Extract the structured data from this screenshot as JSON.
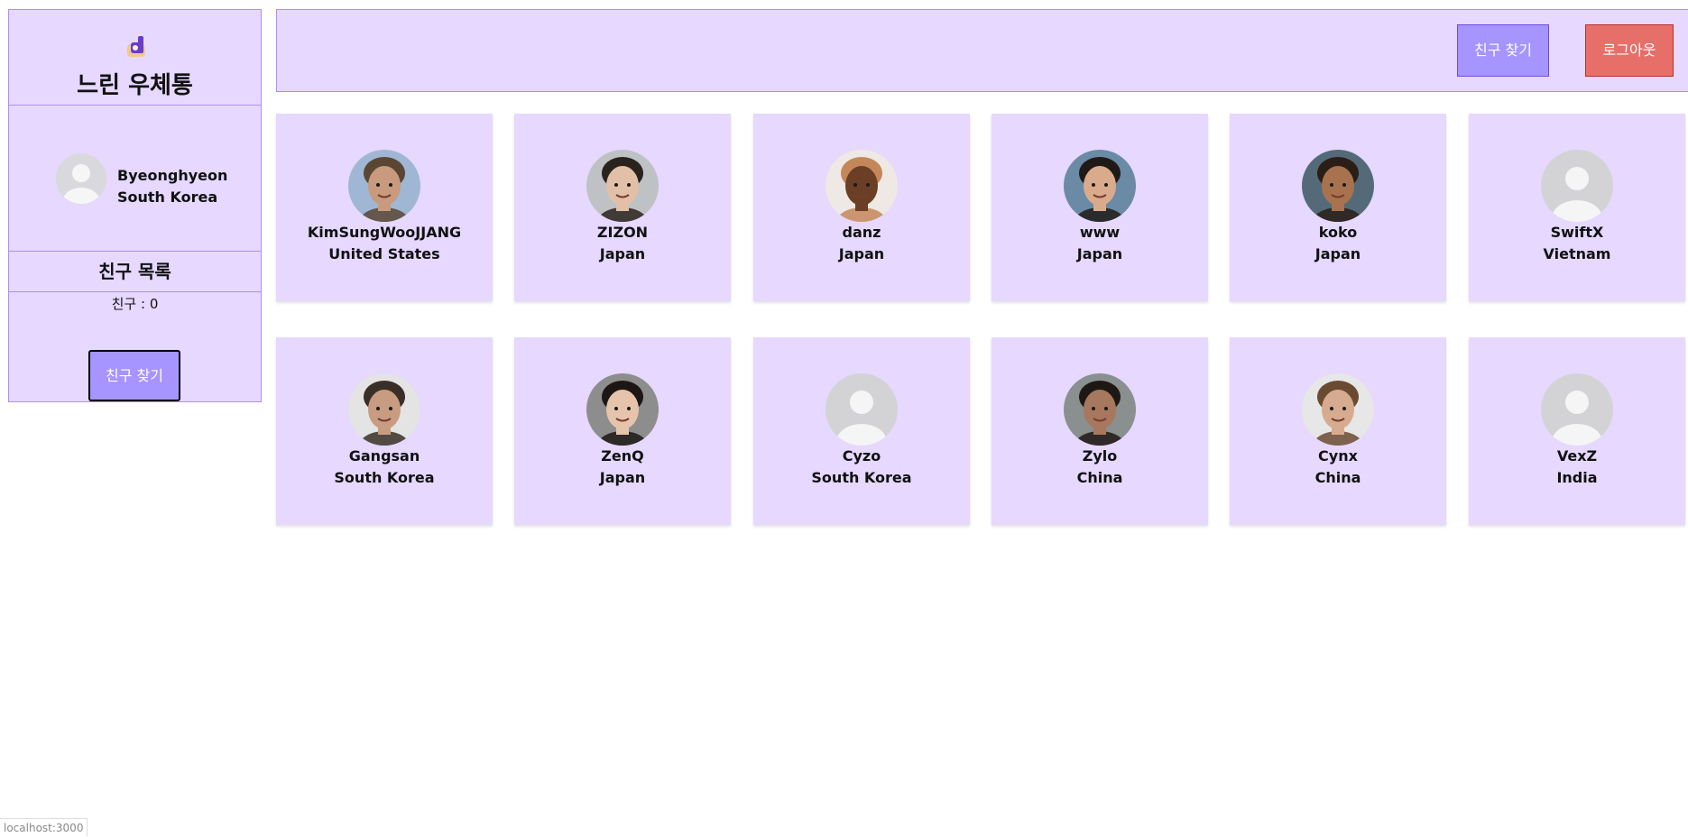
{
  "sidebar": {
    "title": "느린 우체통",
    "profile": {
      "name": "Byeonghyeon",
      "country": "South Korea"
    },
    "friends_header": "친구 목록",
    "friend_count": "친구 : 0",
    "find_button": "친구 찾기"
  },
  "header": {
    "find_button": "친구 찾기",
    "logout_button": "로그아웃"
  },
  "users": [
    {
      "name": "KimSungWooJJANG",
      "country": "United States",
      "avatar": "photo-man-glasses",
      "skin": "#c89a7e",
      "hair": "#5b4634",
      "bg": "#9fb7d4"
    },
    {
      "name": "ZIZON",
      "country": "Japan",
      "avatar": "photo-woman-glasses",
      "skin": "#e2c0a8",
      "hair": "#2a221d",
      "bg": "#bfc2c4"
    },
    {
      "name": "danz",
      "country": "Japan",
      "avatar": "photo-woman-headwrap",
      "skin": "#6b3e26",
      "hair": "#c4875a",
      "bg": "#efe9e5"
    },
    {
      "name": "www",
      "country": "Japan",
      "avatar": "photo-man-short-hair",
      "skin": "#d9ab8c",
      "hair": "#1f1a17",
      "bg": "#6b8aa5"
    },
    {
      "name": "koko",
      "country": "Japan",
      "avatar": "photo-man-smiling",
      "skin": "#a9724f",
      "hair": "#2a1e17",
      "bg": "#556a78"
    },
    {
      "name": "SwiftX",
      "country": "Vietnam",
      "avatar": "default-avatar"
    },
    {
      "name": "Gangsan",
      "country": "South Korea",
      "avatar": "photo-man-glasses-curly",
      "skin": "#c79c80",
      "hair": "#3a2f28",
      "bg": "#e4e4e4"
    },
    {
      "name": "ZenQ",
      "country": "Japan",
      "avatar": "photo-woman-bangs",
      "skin": "#e6c4ac",
      "hair": "#1c1714",
      "bg": "#8d8d8d"
    },
    {
      "name": "Cyzo",
      "country": "South Korea",
      "avatar": "default-avatar"
    },
    {
      "name": "Zylo",
      "country": "China",
      "avatar": "photo-woman-long-hair",
      "skin": "#a7785e",
      "hair": "#1e1815",
      "bg": "#8a8f8f"
    },
    {
      "name": "Cynx",
      "country": "China",
      "avatar": "photo-woman-curly-hair",
      "skin": "#d7ab8f",
      "hair": "#6b4a32",
      "bg": "#e7e7e7"
    },
    {
      "name": "VexZ",
      "country": "India",
      "avatar": "default-avatar"
    }
  ],
  "status_bar": {
    "url": "localhost:3000"
  },
  "colors": {
    "panel_bg": "#e6d8ff",
    "panel_border": "#b28cff",
    "primary_button": "#a694ff",
    "logout_button": "#e76f6a"
  }
}
